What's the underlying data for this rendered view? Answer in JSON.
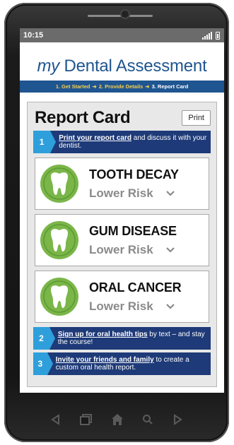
{
  "status": {
    "time": "10:15"
  },
  "app": {
    "title_my": "my",
    "title_rest": " Dental Assessment"
  },
  "breadcrumb": {
    "steps": [
      "1. Get Started",
      "2. Provide Details",
      "3. Report Card"
    ],
    "separator": "➜"
  },
  "report": {
    "title": "Report Card",
    "print_label": "Print",
    "tips": [
      {
        "number": "1",
        "link": "Print your report card",
        "rest": " and discuss it with your dentist."
      },
      {
        "number": "2",
        "link": "Sign up for oral health tips",
        "rest": " by text – and stay the course!"
      },
      {
        "number": "3",
        "link": "Invite your friends and family",
        "rest": " to create a custom oral health report."
      }
    ],
    "risks": [
      {
        "name": "TOOTH DECAY",
        "level": "Lower Risk",
        "icon": "tooth-icon"
      },
      {
        "name": "GUM DISEASE",
        "level": "Lower Risk",
        "icon": "tooth-icon"
      },
      {
        "name": "ORAL CANCER",
        "level": "Lower Risk",
        "icon": "tooth-icon"
      }
    ]
  },
  "colors": {
    "brand_blue": "#1f5590",
    "tip_navy": "#1e3a78",
    "tip_accent": "#2e9fdb",
    "risk_green": "#7ab648",
    "step_yellow": "#f6d04d"
  },
  "nav_icons": [
    "back-icon",
    "recent-apps-icon",
    "home-icon",
    "search-icon",
    "forward-icon"
  ]
}
